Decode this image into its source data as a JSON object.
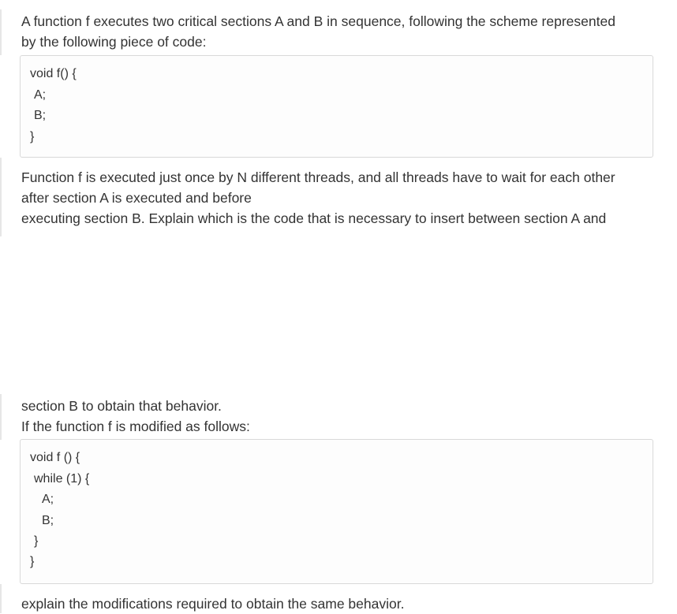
{
  "intro": {
    "line1": "A function f executes two critical sections A and B in sequence, following the scheme represented",
    "line2": "by the following piece of code:"
  },
  "code1": {
    "lines": [
      "void f() {",
      "A;",
      "B;",
      "}"
    ]
  },
  "description": {
    "line1": "Function f is executed just once by N different threads, and all threads have to wait for each other",
    "line2": "after section A is executed and before",
    "line3": "executing section B. Explain which is the code that is necessary to insert between section A and"
  },
  "continuation": {
    "line1": "section B to obtain that behavior.",
    "line2": "If the function f is modified as follows:"
  },
  "code2": {
    "lines": [
      "void f () {",
      "while (1) {",
      "A;",
      "B;",
      "}",
      "}"
    ]
  },
  "closing": {
    "line1": "explain the modifications required to obtain the same behavior."
  }
}
